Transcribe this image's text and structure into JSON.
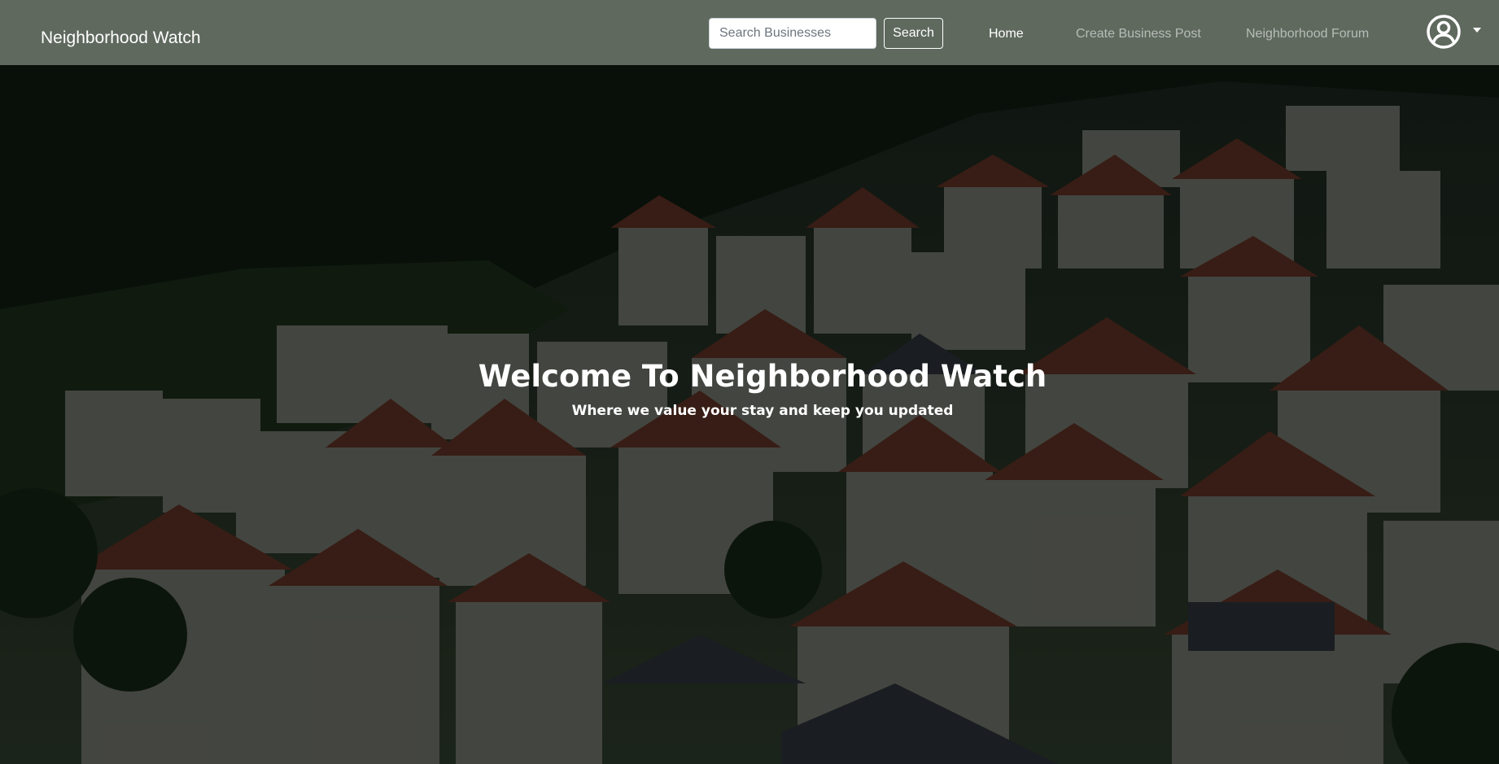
{
  "navbar": {
    "brand": "Neighborhood Watch",
    "search": {
      "placeholder": "Search Businesses",
      "value": "",
      "button_label": "Search"
    },
    "links": [
      {
        "label": "Home",
        "active": true
      },
      {
        "label": "Create Business Post",
        "active": false
      },
      {
        "label": "Neighborhood Forum",
        "active": false
      }
    ],
    "profile_icon": "user-circle-icon",
    "profile_dropdown_icon": "caret-down-icon",
    "background_color": "#5f695e"
  },
  "hero": {
    "title": "Welcome To Neighborhood Watch",
    "subtitle": "Where we value your stay and keep you updated",
    "background_image": "hillside-village-houses-photo"
  }
}
